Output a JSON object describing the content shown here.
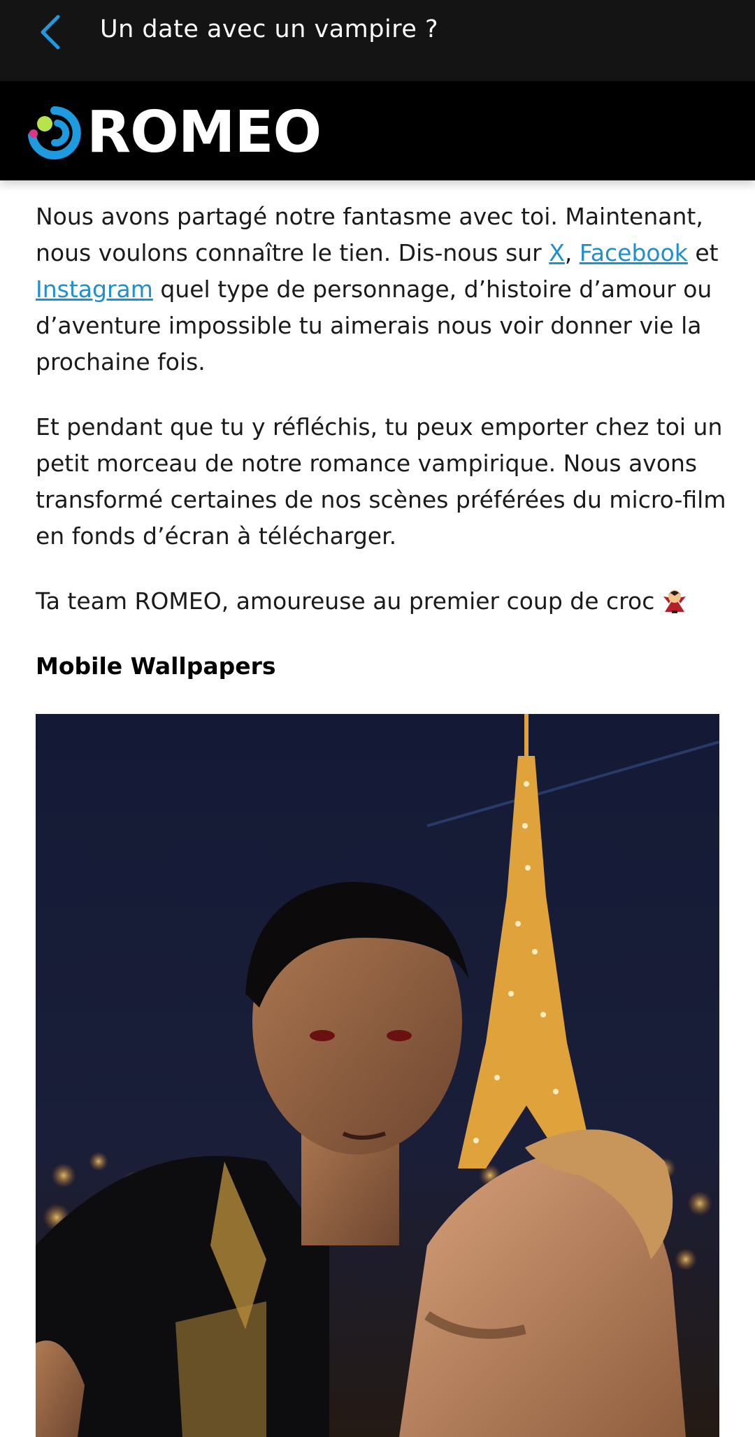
{
  "header": {
    "title": "Un date avec un vampire ?",
    "back_icon": "chevron-left-icon",
    "accent": "#1e9be0"
  },
  "brand": {
    "name": "ROMEO",
    "logo_icon": "romeo-logo-icon"
  },
  "article": {
    "p1": {
      "pre": "Nous avons partagé notre fantasme avec toi. Maintenant, nous voulons connaître le tien. Dis-nous sur ",
      "link_x": "X",
      "sep": ", ",
      "link_facebook": "Facebook",
      "mid": " et ",
      "link_instagram": "Instagram",
      "post": " quel type de personnage, d’histoire d’amour ou d’aventure impossible tu aimerais nous voir donner vie la prochaine fois."
    },
    "p2": "Et pendant que tu y réfléchis, tu peux emporter chez toi un petit morceau de notre romance vampirique. Nous avons transformé certaines de nos scènes préférées du micro-film en fonds d’écran à télécharger.",
    "p3": "Ta team ROMEO, amoureuse au premier coup de croc",
    "p3_icon": "vampire-emoji-icon",
    "section_title": "Mobile Wallpapers",
    "wallpaper_icon": "wallpaper-image-vampire-eiffel-tower"
  },
  "colors": {
    "link": "#1e8fd0",
    "topbar": "#141414",
    "brandbar": "#000000"
  }
}
